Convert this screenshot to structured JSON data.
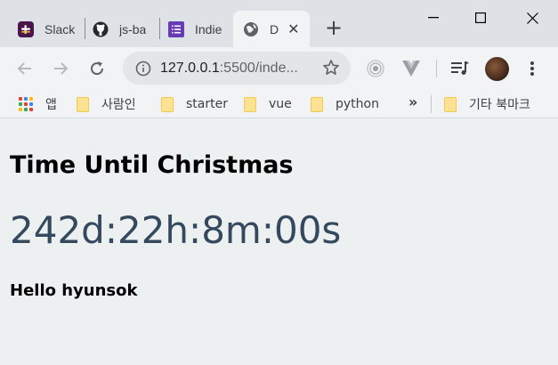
{
  "tabs": [
    {
      "title": "Slack",
      "icon": "slack-icon"
    },
    {
      "title": "js-ba",
      "icon": "github-icon"
    },
    {
      "title": "Indie",
      "icon": "forms-icon"
    },
    {
      "title": "D",
      "icon": "globe-icon",
      "active": true
    }
  ],
  "omnibox": {
    "host": "127.0.0.1",
    "rest": ":5500/inde..."
  },
  "bookmarks": {
    "apps_label": "앱",
    "items": [
      "사람인",
      "starter",
      "vue",
      "python"
    ],
    "other_label": "기타 북마크",
    "overflow": "»"
  },
  "page": {
    "heading": "Time Until Christmas",
    "countdown": "242d:22h:8m:00s",
    "greeting": "Hello hyunsok"
  },
  "colors": {
    "page_background": "#ecf0f1",
    "countdown_text": "#34495e",
    "folder": "#fde293"
  }
}
